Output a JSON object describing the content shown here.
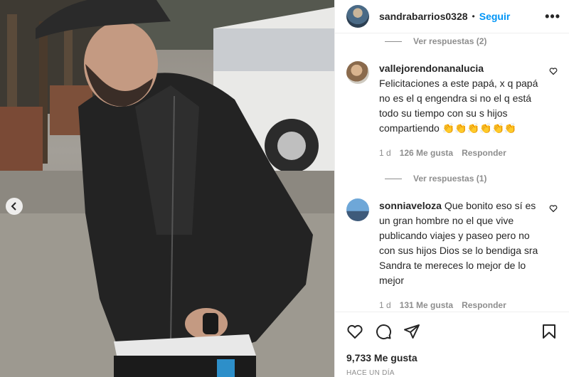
{
  "post": {
    "username": "sandrabarrios0328",
    "separator": "•",
    "follow_label": "Seguir",
    "more_label": "•••"
  },
  "replies_top": "Ver respuestas (2)",
  "comments": [
    {
      "username": "vallejorendonanalucia",
      "text": "Felicitaciones a este papá, x q papá no es el q engendra si no el q está todo su tiempo con su s hijos compartiendo 👏👏👏👏👏👏",
      "age": "1 d",
      "likes": "126 Me gusta",
      "reply": "Responder",
      "replies": "Ver respuestas (1)"
    },
    {
      "username": "sonniaveloza",
      "text": "Que bonito eso sí es un gran hombre no el que vive publicando viajes y paseo pero no con sus hijos Dios se lo bendiga sra Sandra te mereces lo mejor de lo mejor",
      "age": "1 d",
      "likes": "131 Me gusta",
      "reply": "Responder"
    }
  ],
  "likes_count": "9,733 Me gusta",
  "posted": "HACE UN DÍA",
  "icons": {
    "like": "heart-icon",
    "comment": "comment-icon",
    "share": "share-icon",
    "save": "bookmark-icon",
    "prev": "chevron-left-icon"
  },
  "colors": {
    "link": "#0095f6",
    "muted": "#8e8e8e",
    "text": "#262626"
  }
}
